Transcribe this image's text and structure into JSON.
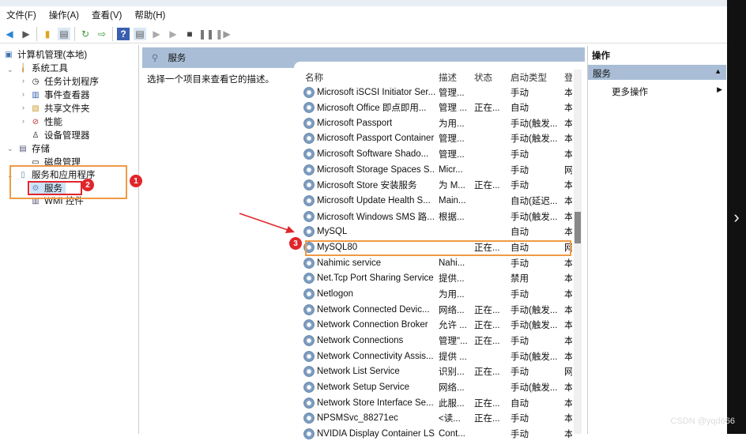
{
  "menu": [
    "文件(F)",
    "操作(A)",
    "查看(V)",
    "帮助(H)"
  ],
  "tree": {
    "root": "计算机管理(本地)",
    "system_tools": "系统工具",
    "task_scheduler": "任务计划程序",
    "event_viewer": "事件查看器",
    "shared_folders": "共享文件夹",
    "performance": "性能",
    "device_manager": "设备管理器",
    "storage": "存储",
    "disk_management": "磁盘管理",
    "services_apps": "服务和应用程序",
    "services": "服务",
    "wmi": "WMI 控件"
  },
  "panel": {
    "title": "服务",
    "description": "选择一个项目来查看它的描述。"
  },
  "columns": {
    "name": "名称",
    "desc": "描述",
    "status": "状态",
    "startup": "启动类型",
    "logon": "登"
  },
  "services": [
    [
      "Microsoft iSCSI Initiator Ser...",
      "管理...",
      "",
      "手动",
      "本"
    ],
    [
      "Microsoft Office 即点即用...",
      "管理 ...",
      "正在...",
      "自动",
      "本"
    ],
    [
      "Microsoft Passport",
      "为用...",
      "",
      "手动(触发...",
      "本"
    ],
    [
      "Microsoft Passport Container",
      "管理...",
      "",
      "手动(触发...",
      "本"
    ],
    [
      "Microsoft Software Shado...",
      "管理...",
      "",
      "手动",
      "本"
    ],
    [
      "Microsoft Storage Spaces S...",
      "Micr...",
      "",
      "手动",
      "网"
    ],
    [
      "Microsoft Store 安装服务",
      "为 M...",
      "正在...",
      "手动",
      "本"
    ],
    [
      "Microsoft Update Health S...",
      "Main...",
      "",
      "自动(延迟...",
      "本"
    ],
    [
      "Microsoft Windows SMS 路...",
      "根据...",
      "",
      "手动(触发...",
      "本"
    ],
    [
      "MySQL",
      "",
      "",
      "自动",
      "本"
    ],
    [
      "MySQL80",
      "",
      "正在...",
      "自动",
      "网"
    ],
    [
      "Nahimic service",
      "Nahi...",
      "",
      "手动",
      "本"
    ],
    [
      "Net.Tcp Port Sharing Service",
      "提供...",
      "",
      "禁用",
      "本"
    ],
    [
      "Netlogon",
      "为用...",
      "",
      "手动",
      "本"
    ],
    [
      "Network Connected Devic...",
      "网络...",
      "正在...",
      "手动(触发...",
      "本"
    ],
    [
      "Network Connection Broker",
      "允许 ...",
      "正在...",
      "手动(触发...",
      "本"
    ],
    [
      "Network Connections",
      "管理\"...",
      "正在...",
      "手动",
      "本"
    ],
    [
      "Network Connectivity Assis...",
      "提供 ...",
      "",
      "手动(触发...",
      "本"
    ],
    [
      "Network List Service",
      "识别...",
      "正在...",
      "手动",
      "网"
    ],
    [
      "Network Setup Service",
      "网络...",
      "",
      "手动(触发...",
      "本"
    ],
    [
      "Network Store Interface Se...",
      "此服...",
      "正在...",
      "自动",
      "本"
    ],
    [
      "NPSMSvc_88271ec",
      "<读...",
      "正在...",
      "手动",
      "本"
    ],
    [
      "NVIDIA Display Container LS",
      "Cont...",
      "",
      "手动",
      "本"
    ]
  ],
  "actions": {
    "header": "操作",
    "section": "服务",
    "more": "更多操作"
  },
  "annotations": [
    "1",
    "2",
    "3"
  ],
  "watermark": "CSDN @yqd666"
}
